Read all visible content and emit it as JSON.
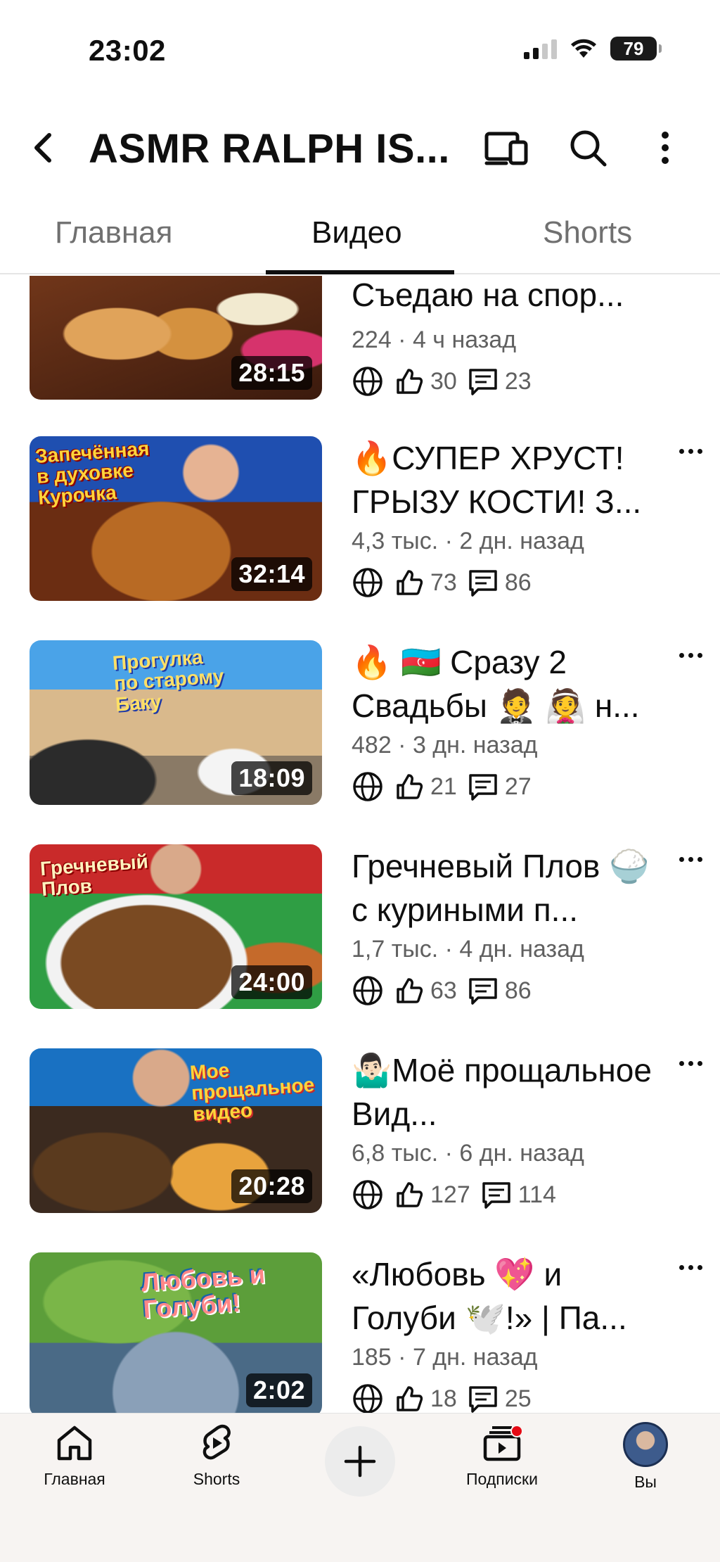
{
  "status_bar": {
    "time": "23:02",
    "battery": "79"
  },
  "header": {
    "channel_title": "ASMR RALPH IS...",
    "icons": [
      "back-arrow-icon",
      "cast-icon",
      "search-icon",
      "more-vert-icon"
    ]
  },
  "tabs": [
    {
      "label": "Главная",
      "active": false
    },
    {
      "label": "Видео",
      "active": true
    },
    {
      "label": "Shorts",
      "active": false
    }
  ],
  "videos": [
    {
      "title": "Съедаю на спор...",
      "meta": "224 · 4 ч назад",
      "likes": "30",
      "comments": "23",
      "duration": "28:15",
      "thumb_text": ""
    },
    {
      "title": "🔥СУПЕР ХРУСТ! ГРЫЗУ КОСТИ! З...",
      "meta": "4,3 тыс. · 2 дн. назад",
      "likes": "73",
      "comments": "86",
      "duration": "32:14",
      "thumb_text": "Запечённая в духовке Курочка"
    },
    {
      "title": "🔥 🇦🇿 Сразу 2 Свадьбы 🤵 👰 н...",
      "meta": "482 · 3 дн. назад",
      "likes": "21",
      "comments": "27",
      "duration": "18:09",
      "thumb_text": "Прогулка по старому Баку"
    },
    {
      "title": "Гречневый Плов 🍚 с куриными п...",
      "meta": "1,7 тыс. · 4 дн. назад",
      "likes": "63",
      "comments": "86",
      "duration": "24:00",
      "thumb_text": "Гречневый Плов"
    },
    {
      "title": "🤷🏻‍♂️Моё прощальное Вид...",
      "meta": "6,8 тыс. · 6 дн. назад",
      "likes": "127",
      "comments": "114",
      "duration": "20:28",
      "thumb_text": "Мое прощальное видео"
    },
    {
      "title": "«Любовь 💖 и Голуби 🕊️!» | Па...",
      "meta": "185 · 7 дн. назад",
      "likes": "18",
      "comments": "25",
      "duration": "2:02",
      "thumb_text": "Любовь и Голуби!"
    }
  ],
  "bottom_nav": [
    {
      "label": "Главная",
      "icon": "home-icon"
    },
    {
      "label": "Shorts",
      "icon": "shorts-icon"
    },
    {
      "label": "",
      "icon": "plus-icon"
    },
    {
      "label": "Подписки",
      "icon": "subscriptions-icon"
    },
    {
      "label": "Вы",
      "icon": "avatar"
    }
  ],
  "colors": {
    "text": "#0f0f0f",
    "secondary": "#606060",
    "accent": "#e50914"
  }
}
